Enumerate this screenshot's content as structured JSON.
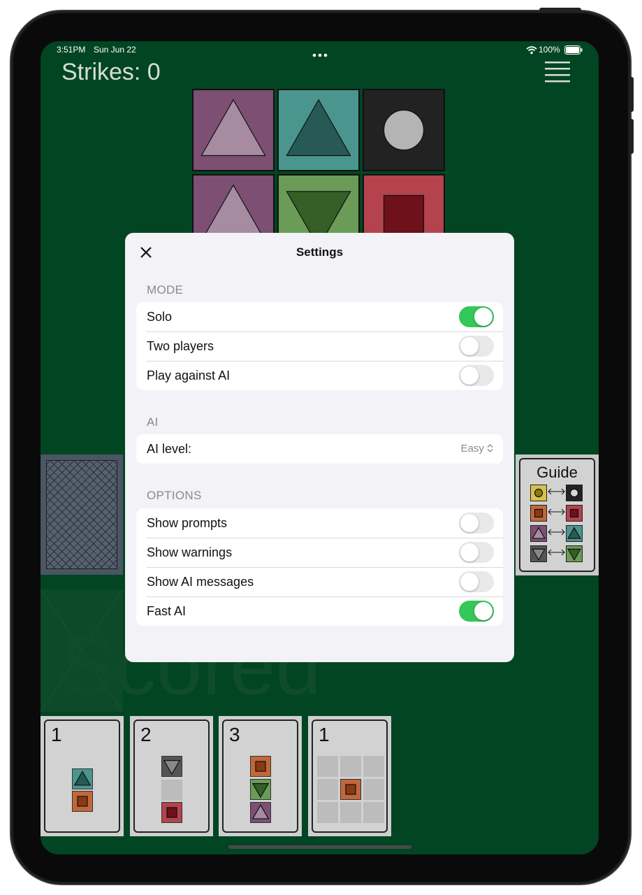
{
  "status_bar": {
    "time": "3:51PM",
    "date": "Sun Jun 22",
    "battery": "100%"
  },
  "header": {
    "strikes": "Strikes: 0"
  },
  "colors": {
    "background": "#024523",
    "toggle_on": "#34c759",
    "toggle_off": "#e9e9eb"
  },
  "board": {
    "tiles": [
      {
        "color": "#7d4f73",
        "shape": "triangle-up",
        "shape_color": "#a68ba1"
      },
      {
        "color": "#4a968f",
        "shape": "triangle-up",
        "shape_color": "#275a55"
      },
      {
        "color": "#222222",
        "shape": "circle",
        "shape_color": "#b4b4b4"
      },
      {
        "color": "#7d4f73",
        "shape": "triangle-up",
        "shape_color": "#a68ba1"
      },
      {
        "color": "#6a9c57",
        "shape": "triangle-down",
        "shape_color": "#355f26"
      },
      {
        "color": "#b4434d",
        "shape": "square",
        "shape_color": "#6e111a"
      }
    ]
  },
  "guide": {
    "title": "Guide"
  },
  "hand_cards": [
    {
      "number": "1"
    },
    {
      "number": "2"
    },
    {
      "number": "3"
    },
    {
      "number": "1"
    }
  ],
  "settings": {
    "title": "Settings",
    "mode": {
      "header": "MODE",
      "rows": [
        {
          "label": "Solo",
          "on": true
        },
        {
          "label": "Two players",
          "on": false
        },
        {
          "label": "Play against AI",
          "on": false
        }
      ]
    },
    "ai": {
      "header": "AI",
      "level_label": "AI level:",
      "level_value": "Easy"
    },
    "options": {
      "header": "OPTIONS",
      "rows": [
        {
          "label": "Show prompts",
          "on": false
        },
        {
          "label": "Show warnings",
          "on": false
        },
        {
          "label": "Show AI messages",
          "on": false
        },
        {
          "label": "Fast AI",
          "on": true
        }
      ]
    }
  }
}
